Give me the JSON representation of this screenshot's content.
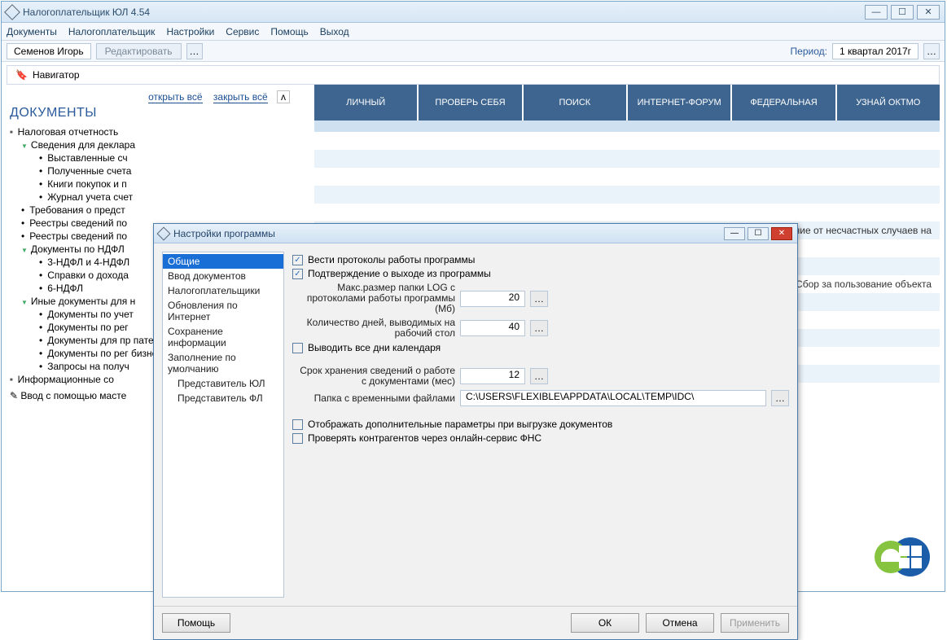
{
  "window": {
    "title": "Налогоплательщик ЮЛ 4.54"
  },
  "menubar": [
    "Документы",
    "Налогоплательщик",
    "Настройки",
    "Сервис",
    "Помощь",
    "Выход"
  ],
  "toolbar": {
    "user": "Семенов Игорь",
    "edit": "Редактировать",
    "period_label": "Период:",
    "period_value": "1 квартал 2017г"
  },
  "nav": {
    "label": "Навигатор"
  },
  "side": {
    "open_all": "открыть всё",
    "close_all": "закрыть всё",
    "title": "ДОКУМЕНТЫ",
    "items": [
      "Налоговая отчетность",
      "Сведения для деклара",
      "Выставленные сч",
      "Полученные счета",
      "Книги покупок и п",
      "Журнал учета счет",
      "Требования о предст",
      "Реестры сведений по",
      "Реестры сведений по",
      "Документы по НДФЛ",
      "3-НДФЛ и 4-НДФЛ",
      "Справки о дохода",
      "6-НДФЛ",
      "Иные документы для н",
      "Документы по учет",
      "Документы по рег",
      "Документы для пр патентной системы",
      "Документы по рег бизнеса",
      "Запросы на получ",
      "Информационные со",
      "Ввод с помощью масте"
    ]
  },
  "tabs": [
    "ЛИЧНЫЙ",
    "ПРОВЕРЬ СЕБЯ",
    "ПОИСК",
    "ИНТЕРНЕТ-ФОРУМ",
    "ФЕДЕРАЛЬНАЯ",
    "УЗНАЙ ОКТМО"
  ],
  "bgrows": [
    "",
    "вание от несчастных случаев на",
    "",
    "ес, Сбор за пользование объекта"
  ],
  "modal": {
    "title": "Настройки программы",
    "sidelist": [
      {
        "label": "Общие",
        "sel": true
      },
      {
        "label": "Ввод документов"
      },
      {
        "label": "Налогоплательщики"
      },
      {
        "label": "Обновления по Интернет"
      },
      {
        "label": "Сохранение информации"
      },
      {
        "label": "Заполнение по умолчанию"
      },
      {
        "label": "Представитель ЮЛ",
        "indent": true
      },
      {
        "label": "Представитель ФЛ",
        "indent": true
      }
    ],
    "form": {
      "chk_protocols": "Вести протоколы работы программы",
      "chk_confirm": "Подтверждение о выходе из программы",
      "lbl_logsize": "Макс.размер папки LOG с протоколами работы программы (Мб)",
      "val_logsize": "20",
      "lbl_days": "Количество дней, выводимых на рабочий стол",
      "val_days": "40",
      "chk_alldays": "Выводить все дни календаря",
      "lbl_keep": "Срок хранения сведений о работе с документами (мес)",
      "val_keep": "12",
      "lbl_temp": "Папка с временными файлами",
      "val_temp": "C:\\USERS\\FLEXIBLE\\APPDATA\\LOCAL\\TEMP\\IDC\\",
      "chk_extra": "Отображать дополнительные параметры при выгрузке документов",
      "chk_verify": "Проверять контрагентов через онлайн-сервис ФНС"
    },
    "footer": {
      "help": "Помощь",
      "ok": "ОК",
      "cancel": "Отмена",
      "apply": "Применить"
    }
  }
}
